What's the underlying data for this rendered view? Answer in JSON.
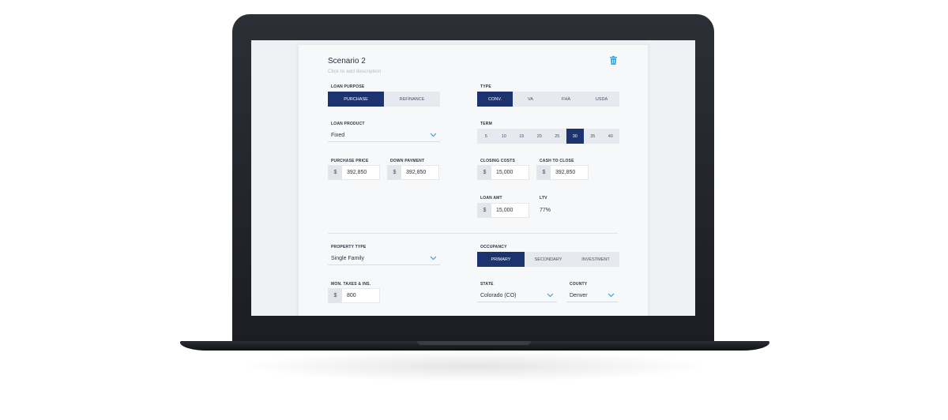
{
  "scenario": {
    "title": "Scenario 2",
    "description_placeholder": "Click to add description"
  },
  "loan_purpose": {
    "label": "LOAN PURPOSE",
    "options": [
      "PURCHASE",
      "REFINANCE"
    ],
    "selected": "PURCHASE"
  },
  "type": {
    "label": "TYPE",
    "options": [
      "CONV.",
      "VA",
      "FHA",
      "USDA"
    ],
    "selected": "CONV."
  },
  "loan_product": {
    "label": "LOAN PRODUCT",
    "value": "Fixed"
  },
  "term": {
    "label": "TERM",
    "options": [
      "5",
      "10",
      "15",
      "20",
      "25",
      "30",
      "35",
      "40"
    ],
    "selected": "30"
  },
  "purchase_price": {
    "label": "PURCHASE PRICE",
    "currency": "$",
    "value": "392,850"
  },
  "down_payment": {
    "label": "DOWN PAYMENT",
    "currency": "$",
    "value": "392,850"
  },
  "closing_costs": {
    "label": "CLOSING COSTS",
    "currency": "$",
    "value": "15,000"
  },
  "cash_to_close": {
    "label": "CASH TO CLOSE",
    "currency": "$",
    "value": "392,850"
  },
  "loan_amt": {
    "label": "LOAN AMT",
    "currency": "$",
    "value": "15,000"
  },
  "ltv": {
    "label": "LTV",
    "value": "77%"
  },
  "property_type": {
    "label": "PROPERTY TYPE",
    "value": "Single Family"
  },
  "occupancy": {
    "label": "OCCUPANCY",
    "options": [
      "PRIMARY",
      "SECONDARY",
      "INVESTMENT"
    ],
    "selected": "PRIMARY"
  },
  "taxes_ins": {
    "label": "MON. TAXES & INS.",
    "currency": "$",
    "value": "800"
  },
  "state": {
    "label": "STATE",
    "value": "Colorado (CO)"
  },
  "county": {
    "label": "COUNTY",
    "value": "Denver"
  },
  "colors": {
    "accent": "#1d3370",
    "chevron": "#3aa3d8",
    "frame": "#1f2126"
  }
}
